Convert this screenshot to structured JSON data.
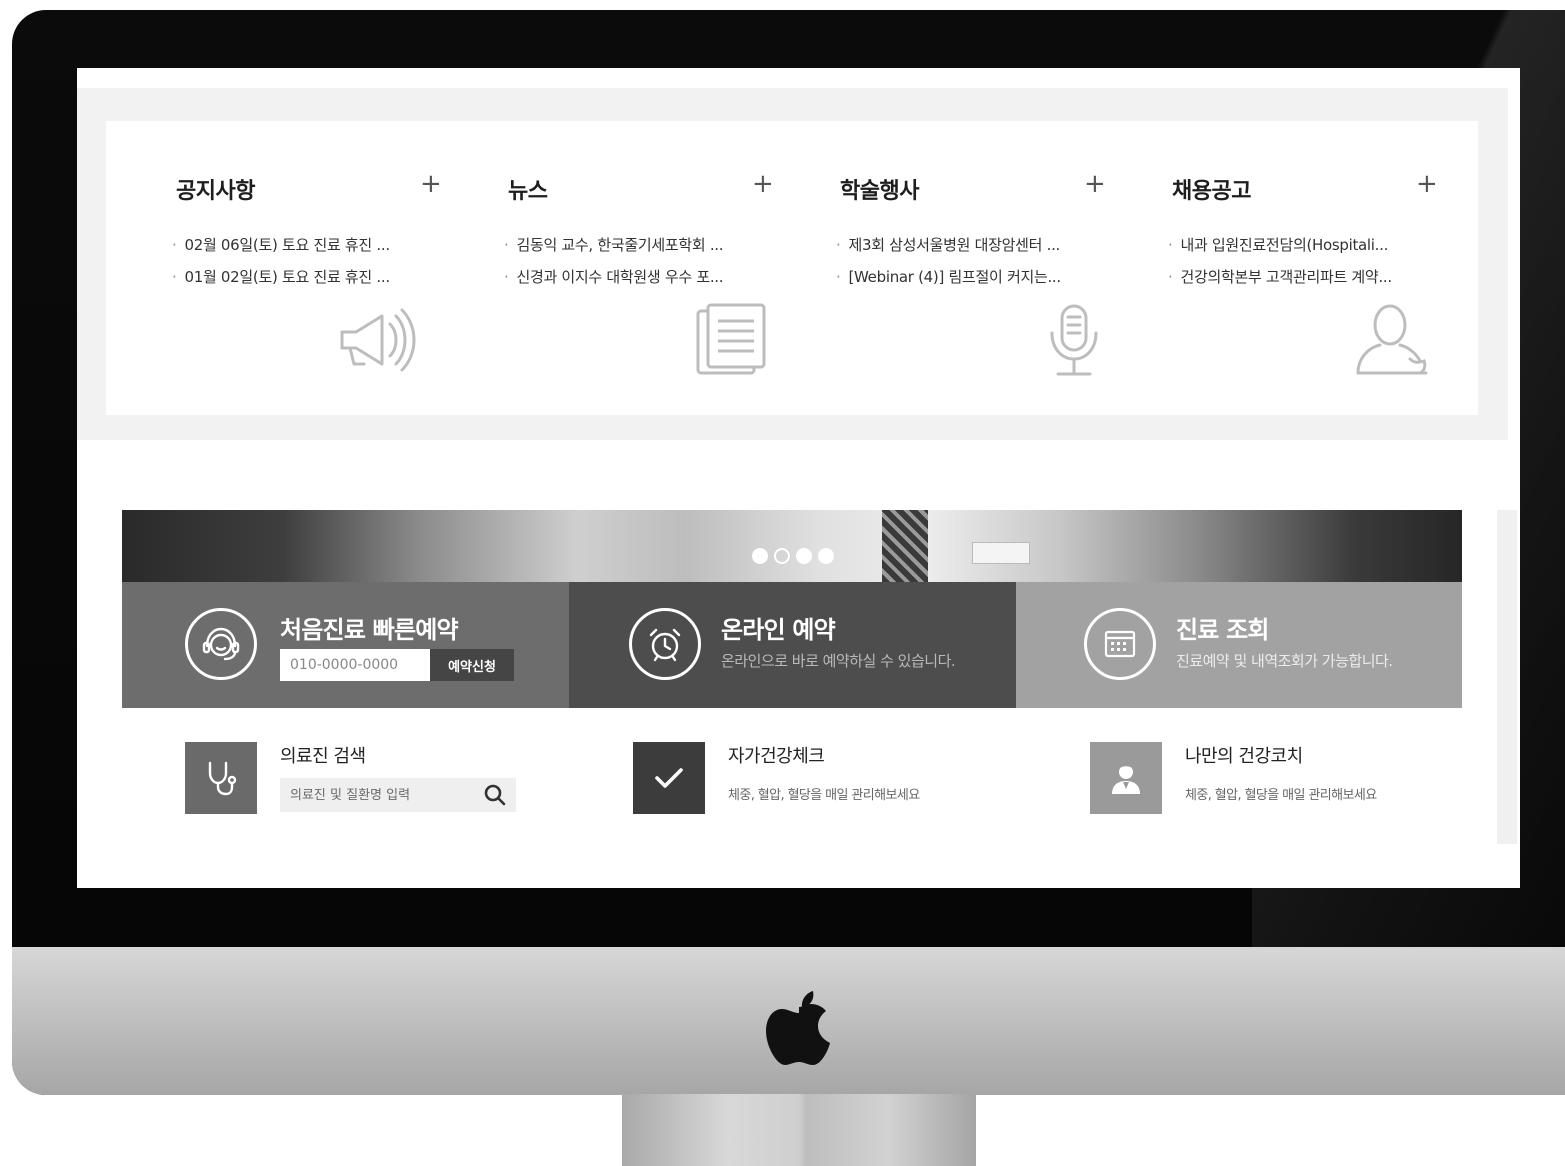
{
  "boards": [
    {
      "title": "공지사항",
      "more": "+",
      "items": [
        "02월 06일(토) 토요 진료 휴진 ...",
        "01월 02일(토) 토요 진료 휴진 ..."
      ],
      "icon": "megaphone-icon"
    },
    {
      "title": "뉴스",
      "more": "+",
      "items": [
        "김동익 교수, 한국줄기세포학회 ...",
        "신경과 이지수 대학원생 우수 포..."
      ],
      "icon": "document-icon"
    },
    {
      "title": "학술행사",
      "more": "+",
      "items": [
        "제3회 삼성서울병원 대장암센터 ...",
        "[Webinar (4)] 림프절이 커지는..."
      ],
      "icon": "microphone-icon"
    },
    {
      "title": "채용공고",
      "more": "+",
      "items": [
        "내과 입원진료전담의(Hospitali...",
        "건강의학본부 고객관리파트 계약..."
      ],
      "icon": "person-icon"
    }
  ],
  "bullet": "·",
  "slider": {
    "count": 4,
    "active": 1
  },
  "quick": {
    "first_visit": {
      "title": "처음진료 빠른예약",
      "phone_placeholder": "010-0000-0000",
      "button": "예약신청",
      "icon": "headset-icon"
    },
    "online": {
      "title": "온라인 예약",
      "desc": "온라인으로 바로 예약하실 수 있습니다.",
      "icon": "alarm-clock-icon"
    },
    "lookup": {
      "title": "진료 조회",
      "desc": "진료예약 및 내역조회가 가능합니다.",
      "icon": "calendar-icon"
    }
  },
  "services": {
    "doctor_search": {
      "title": "의료진 검색",
      "placeholder": "의료진 및 질환명 입력",
      "icon": "stethoscope-icon"
    },
    "self_check": {
      "title": "자가건강체크",
      "desc": "체중, 혈압, 혈당을 매일 관리해보세요",
      "icon": "checkmark-icon"
    },
    "coach": {
      "title": "나만의 건강코치",
      "desc": "체중, 혈압, 혈당을 매일 관리해보세요",
      "icon": "doctor-icon"
    }
  },
  "colors": {
    "panel_first": "#6d6d6d",
    "panel_online": "#4d4d4d",
    "panel_lookup": "#a2a2a2",
    "board_bg": "#f2f2f2"
  }
}
